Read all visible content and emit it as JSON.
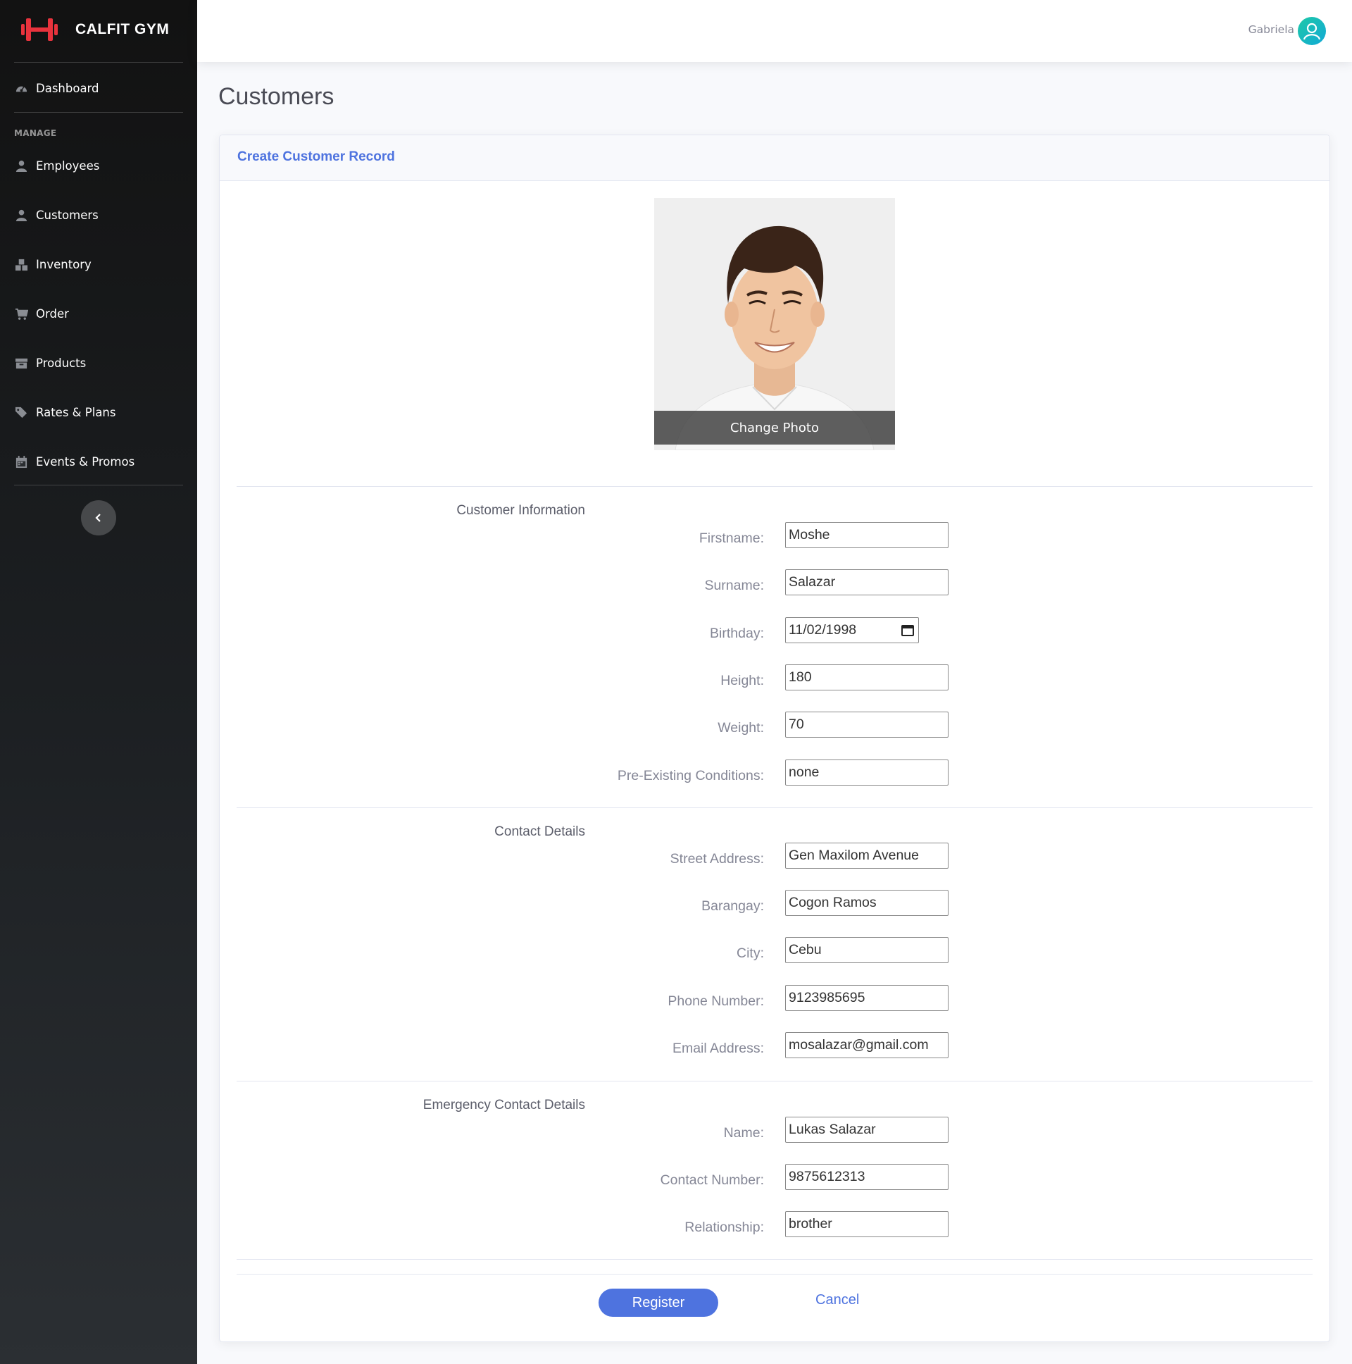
{
  "brand": {
    "name": "CALFIT GYM",
    "logo_icon": "dumbbell-icon",
    "accent_color": "#e8333d"
  },
  "sidebar": {
    "dashboard": {
      "label": "Dashboard",
      "icon": "tachometer-icon"
    },
    "heading": "MANAGE",
    "items": [
      {
        "label": "Employees",
        "icon": "user-icon"
      },
      {
        "label": "Customers",
        "icon": "user-icon"
      },
      {
        "label": "Inventory",
        "icon": "boxes-icon"
      },
      {
        "label": "Order",
        "icon": "cart-icon"
      },
      {
        "label": "Products",
        "icon": "box-icon"
      },
      {
        "label": "Rates & Plans",
        "icon": "tags-icon"
      },
      {
        "label": "Events & Promos",
        "icon": "calendar-icon"
      }
    ],
    "toggle_icon": "chevron-left-icon"
  },
  "topbar": {
    "user_name": "Gabriela",
    "avatar_icon": "user-circle-icon",
    "avatar_color": "#17b9c0"
  },
  "page": {
    "title": "Customers"
  },
  "card": {
    "title": "Create Customer Record",
    "change_photo_label": "Change Photo",
    "sections": {
      "customer_info": {
        "title": "Customer Information",
        "fields": {
          "firstname": {
            "label": "Firstname:",
            "value": "Moshe"
          },
          "surname": {
            "label": "Surname:",
            "value": "Salazar"
          },
          "birthday": {
            "label": "Birthday:",
            "value": "11/02/1998"
          },
          "height": {
            "label": "Height:",
            "value": "180"
          },
          "weight": {
            "label": "Weight:",
            "value": "70"
          },
          "conditions": {
            "label": "Pre-Existing Conditions:",
            "value": "none"
          }
        }
      },
      "contact": {
        "title": "Contact Details",
        "fields": {
          "street": {
            "label": "Street Address:",
            "value": "Gen Maxilom Avenue"
          },
          "barangay": {
            "label": "Barangay:",
            "value": "Cogon Ramos"
          },
          "city": {
            "label": "City:",
            "value": "Cebu"
          },
          "phone": {
            "label": "Phone Number:",
            "value": "9123985695"
          },
          "email": {
            "label": "Email Address:",
            "value": "mosalazar@gmail.com"
          }
        }
      },
      "emergency": {
        "title": "Emergency Contact Details",
        "fields": {
          "name": {
            "label": "Name:",
            "value": "Lukas Salazar"
          },
          "contact_number": {
            "label": "Contact Number:",
            "value": "9875612313"
          },
          "relationship": {
            "label": "Relationship:",
            "value": "brother"
          }
        }
      }
    },
    "actions": {
      "register_label": "Register",
      "cancel_label": "Cancel"
    }
  }
}
